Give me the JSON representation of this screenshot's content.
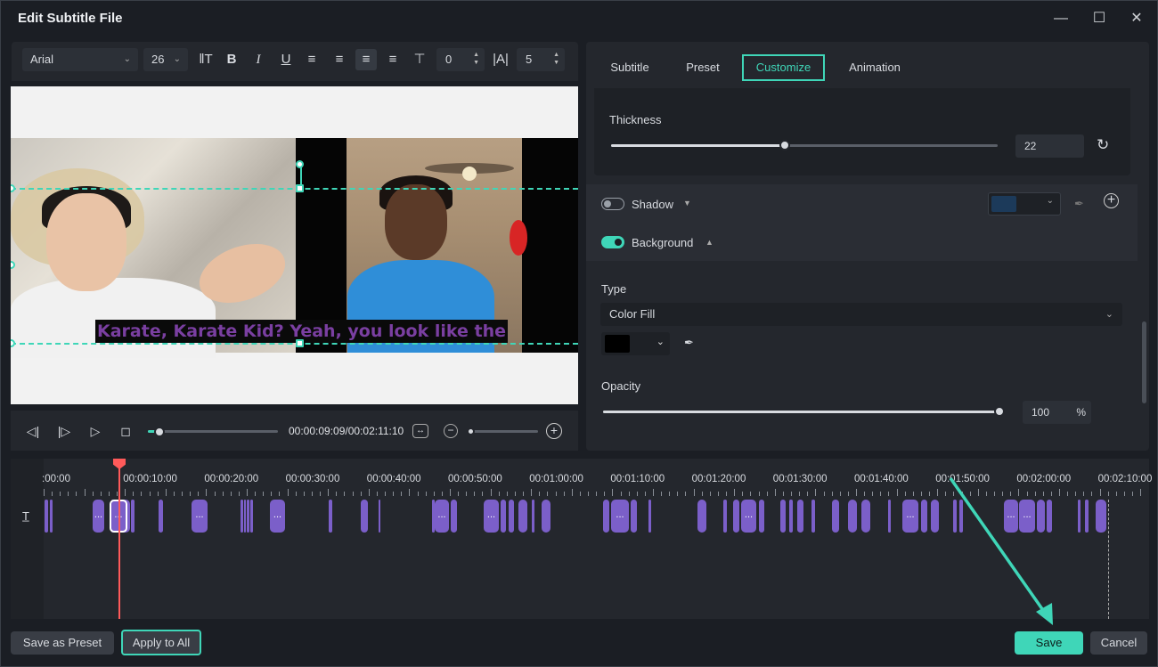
{
  "window": {
    "title": "Edit Subtitle File",
    "minimize_icon": "minimize-icon",
    "maximize_icon": "maximize-icon",
    "close_icon": "close-icon"
  },
  "toolbar": {
    "font": "Arial",
    "size": "26",
    "letter_spacing": "0",
    "line_spacing": "5",
    "icons": [
      "text-spacing-icon",
      "bold-icon",
      "italic-icon",
      "underline-icon",
      "align-left-icon",
      "align-right-icon",
      "align-center-icon",
      "justify-icon",
      "text-top-icon"
    ]
  },
  "preview": {
    "subtitle": "Karate, Karate Kid? Yeah, you look like the"
  },
  "playback": {
    "time": "00:00:09:09/00:02:11:10"
  },
  "tabs": [
    {
      "label": "Subtitle"
    },
    {
      "label": "Preset"
    },
    {
      "label": "Customize",
      "active": true
    },
    {
      "label": "Animation"
    }
  ],
  "customize": {
    "thickness_label": "Thickness",
    "thickness_value": "22",
    "thickness_level": 0.45,
    "shadow_label": "Shadow",
    "shadow_on": false,
    "shadow_color": "#1c3a5a",
    "background_label": "Background",
    "background_on": true,
    "type_label": "Type",
    "type_value": "Color Fill",
    "fill_color": "#000000",
    "opacity_label": "Opacity",
    "opacity_value": "100",
    "opacity_unit": "%",
    "opacity_level": 1.0
  },
  "timeline": {
    "ruler": [
      ":00:00",
      "00:00:10:00",
      "00:00:20:00",
      "00:00:30:00",
      "00:00:40:00",
      "00:00:50:00",
      "00:01:00:00",
      "00:01:10:00",
      "00:01:20:00",
      "00:01:30:00",
      "00:01:40:00",
      "00:01:50:00",
      "00:02:00:00",
      "00:02:10:00"
    ],
    "track_icon": "text-track-icon",
    "clip_label": "..."
  },
  "footer": {
    "save_preset": "Save as Preset",
    "apply_all": "Apply to All",
    "save": "Save",
    "cancel": "Cancel"
  },
  "colors": {
    "accent": "#3fd6b8",
    "clip": "#7b5fc9",
    "playhead": "#ff5a5a"
  }
}
